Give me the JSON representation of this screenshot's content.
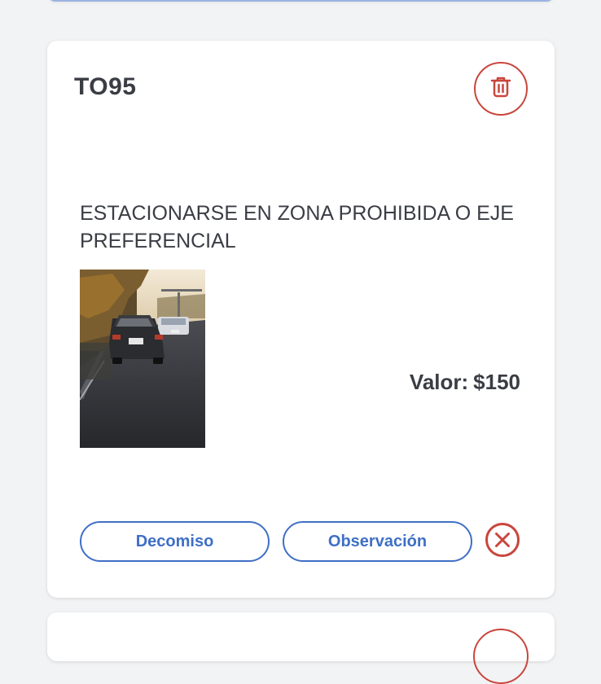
{
  "infraction": {
    "code": "TO95",
    "description": "ESTACIONARSE EN ZONA PROHIBIDA O EJE PREFERENCIAL",
    "valor_label": "Valor:",
    "valor_amount": "$150"
  },
  "actions": {
    "decomiso_label": "Decomiso",
    "observacion_label": "Observación"
  },
  "icons": {
    "delete": "trash-icon",
    "cancel": "close-circle-icon"
  },
  "colors": {
    "danger": "#c9463d",
    "primary": "#3f6fc6",
    "text": "#3a3d44",
    "background": "#f2f3f5"
  }
}
